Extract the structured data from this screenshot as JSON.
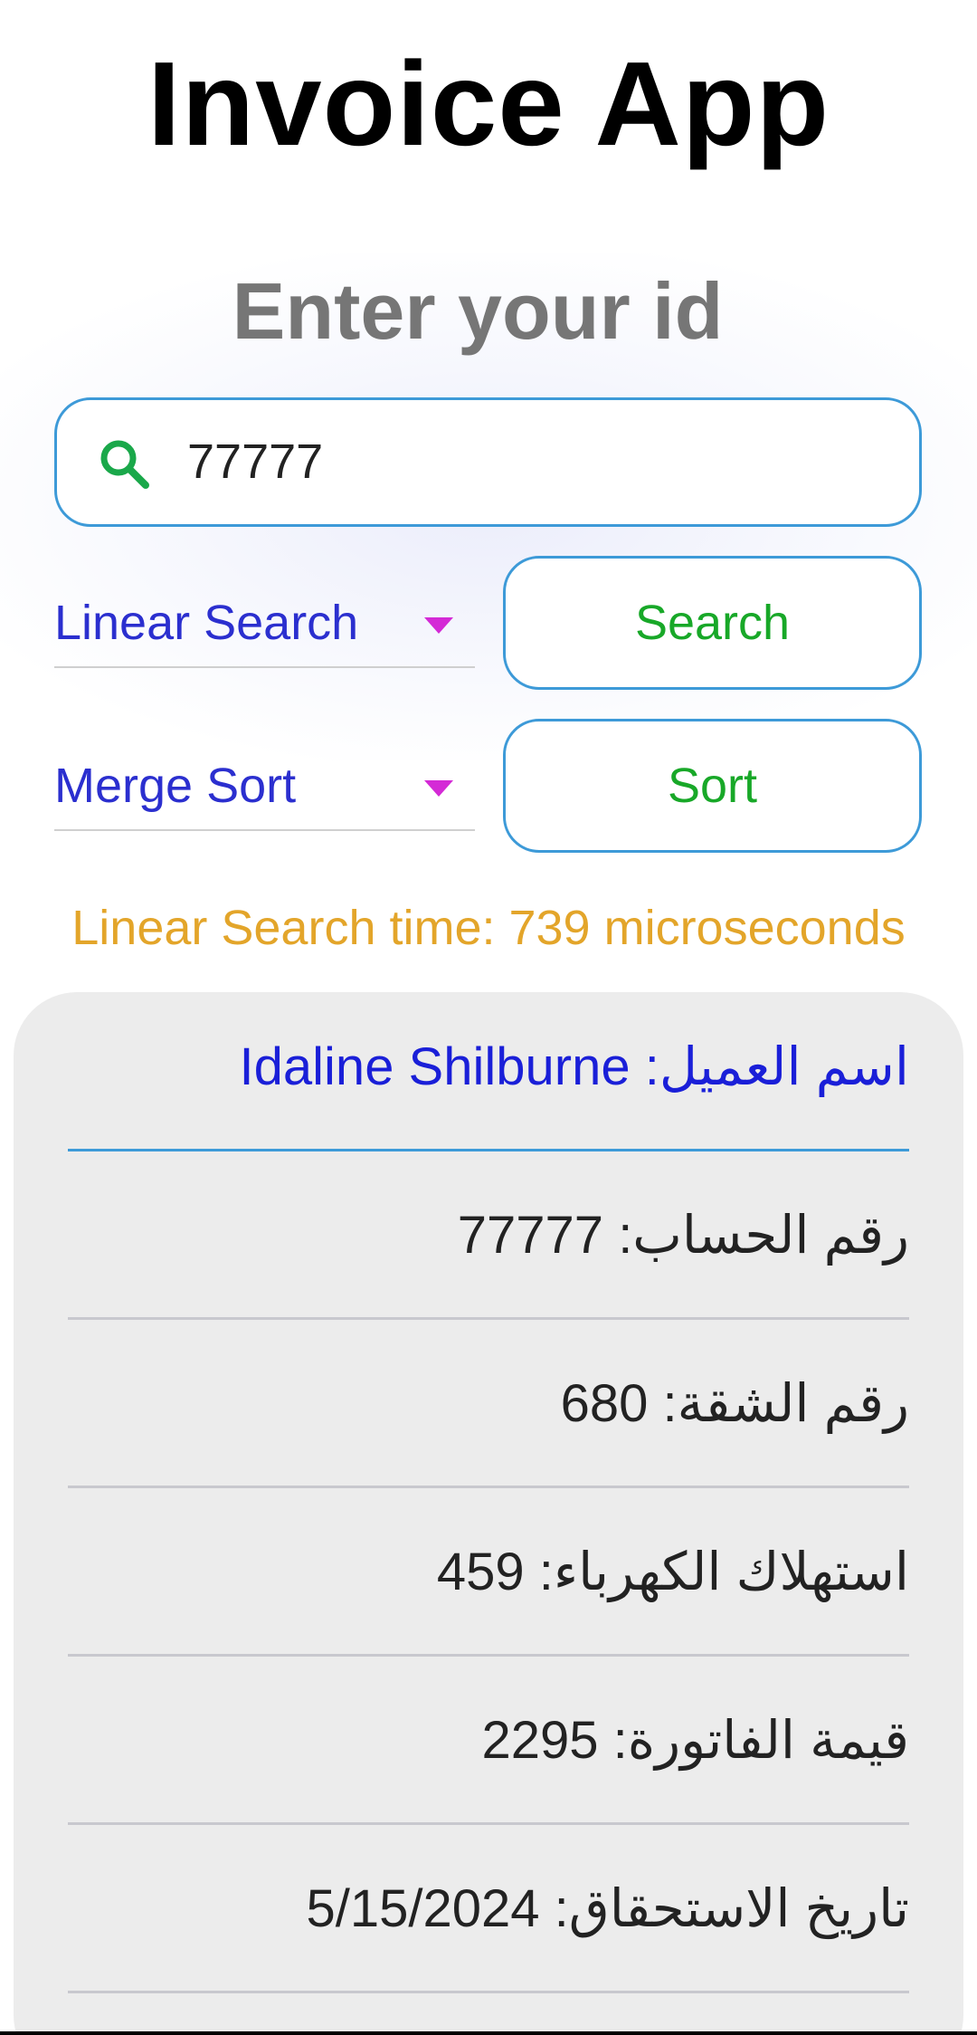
{
  "app": {
    "title": "Invoice App",
    "subtitle": "Enter your id"
  },
  "search": {
    "value": "77777",
    "icon": "search-icon"
  },
  "controls": {
    "search_algorithm": "Linear Search",
    "search_button": "Search",
    "sort_algorithm": "Merge Sort",
    "sort_button": "Sort"
  },
  "status": {
    "time_text": "Linear Search time: 739 microseconds"
  },
  "invoice": {
    "customer_name": "Idaline Shilburne :اسم العميل",
    "account_number": "رقم الحساب: 77777",
    "apartment_number": "رقم الشقة: 680",
    "electricity_consumption": "استهلاك الكهرباء: 459",
    "invoice_amount": "قيمة الفاتورة: 2295",
    "due_date": "تاريخ الاستحقاق: 5/15/2024"
  },
  "colors": {
    "accent_border": "#3d9ad8",
    "button_text": "#18a828",
    "dropdown_text": "#2b2fcf",
    "dropdown_caret": "#d42ad6",
    "status_text": "#e3a52a",
    "customer_text": "#1a1fd8"
  }
}
